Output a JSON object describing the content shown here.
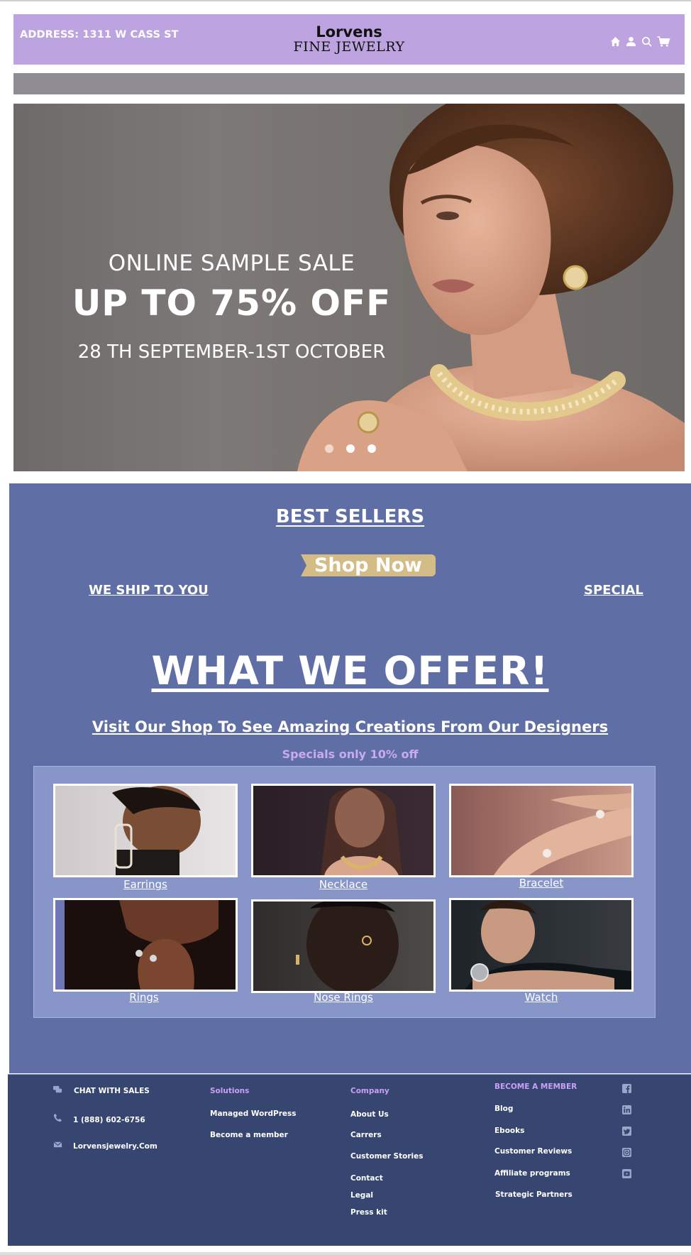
{
  "header": {
    "address": "ADDRESS: 1311 W CASS ST",
    "logo_top": "Lorvens",
    "logo_bottom": "FINE JEWELRY",
    "icons": [
      "home-icon",
      "user-icon",
      "search-icon",
      "cart-icon"
    ]
  },
  "hero": {
    "line1": "ONLINE SAMPLE SALE",
    "line2": "UP TO 75% OFF",
    "line3": "28 TH SEPTEMBER-1ST OCTOBER",
    "slide_count": 3,
    "active_slide": 1
  },
  "main": {
    "best_sellers": "BEST SELLERS",
    "shop_now": "Shop Now",
    "ship": "WE SHIP TO YOU",
    "special": "SPECIAL",
    "offer_title": "WHAT WE OFFER!",
    "visit": "Visit Our Shop To See Amazing Creations From Our Designers",
    "specials_note": "Specials only 10% off",
    "categories": [
      {
        "label": "Earrings"
      },
      {
        "label": "Necklace"
      },
      {
        "label": "Bracelet"
      },
      {
        "label": "Rings"
      },
      {
        "label": "Nose Rings"
      },
      {
        "label": "Watch"
      }
    ]
  },
  "footer": {
    "contact": {
      "chat": "CHAT WITH SALES",
      "phone": "1 (888) 602-6756",
      "site": "Lorvensjewelry.Com"
    },
    "solutions": {
      "heading": "Solutions",
      "items": [
        "Managed WordPress",
        "Become a member"
      ]
    },
    "company": {
      "heading": "Company",
      "items": [
        "About Us",
        "Carrers",
        "Customer Stories",
        "Contact",
        "Legal",
        "Press kit"
      ]
    },
    "member": {
      "heading": "BECOME A MEMBER",
      "items": [
        "Blog",
        "Ebooks",
        "Customer Reviews",
        "Affiliate programs",
        "Strategic Partners"
      ]
    },
    "social_icons": [
      "facebook-icon",
      "linkedin-icon",
      "twitter-icon",
      "instagram-icon",
      "youtube-icon"
    ]
  },
  "colors": {
    "header_bg": "#bda3e0",
    "section_bg": "#5f6fa5",
    "footer_bg": "#364670",
    "accent_gold": "#d4bc86",
    "accent_lilac": "#c9a0f5"
  }
}
